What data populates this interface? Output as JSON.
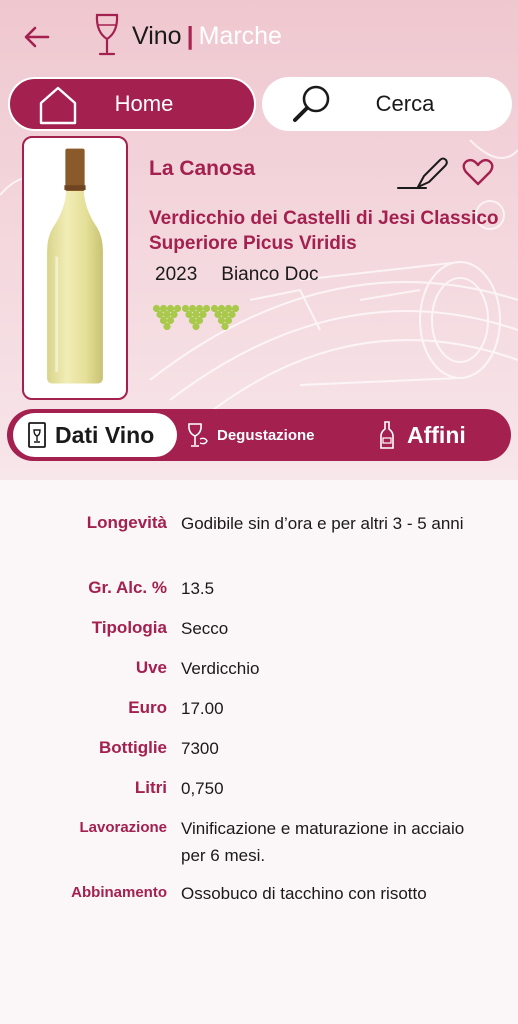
{
  "header": {
    "title_main": "Vino",
    "title_separator": "|",
    "title_region": "Marche"
  },
  "nav": {
    "home_label": "Home",
    "search_label": "Cerca"
  },
  "wine": {
    "producer": "La Canosa",
    "name": "Verdicchio dei Castelli di Jesi Classico Superiore Picus Viridis",
    "year": "2023",
    "type": "Bianco Doc",
    "grape_rating": 3
  },
  "tabs": {
    "dati": "Dati Vino",
    "degustazione": "Degustazione",
    "affini": "Affini"
  },
  "details": [
    {
      "key": "Longevità",
      "value": "Godibile sin d’ora e per altri 3 - 5 anni"
    },
    {
      "key": "Gr. Alc. %",
      "value": "13.5"
    },
    {
      "key": "Tipologia",
      "value": "Secco"
    },
    {
      "key": "Uve",
      "value": "Verdicchio"
    },
    {
      "key": "Euro",
      "value": "17.00"
    },
    {
      "key": "Bottiglie",
      "value": "7300"
    },
    {
      "key": "Litri",
      "value": "0,750"
    },
    {
      "key": "Lavorazione",
      "value": "Vinificazione e maturazione in acciaio per 6 mesi."
    },
    {
      "key": "Abbinamento",
      "value": "Ossobuco di tacchino con risotto"
    }
  ],
  "colors": {
    "brand": "#a3204f",
    "grape_green": "#a8c94a",
    "header_bg": "#efc7cf"
  }
}
